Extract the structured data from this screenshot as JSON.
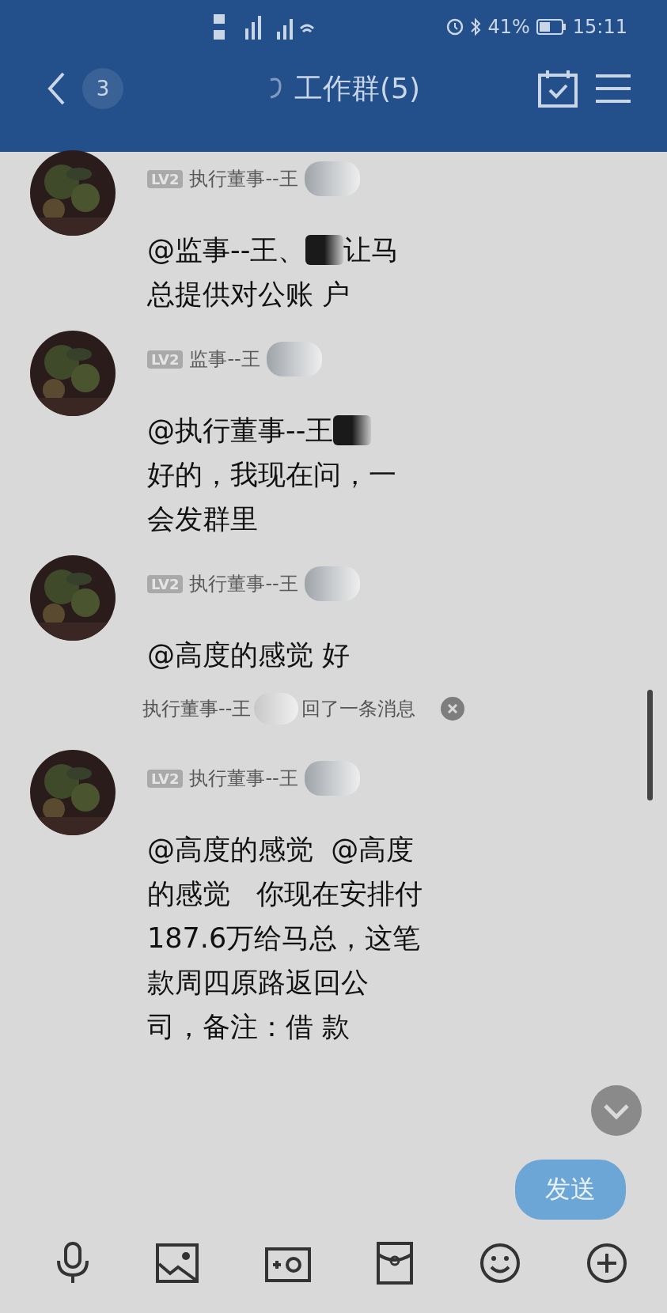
{
  "status_bar": {
    "battery": "41%",
    "time": "15:11"
  },
  "header": {
    "unread": "3",
    "title": "工作群(5)"
  },
  "messages": [
    {
      "kind": "message",
      "badge": "LV2",
      "sender": "执行董事--王",
      "sender_redacted": true,
      "lines": [
        {
          "before": "@监事--王、",
          "redacted": true,
          "after": "让马"
        },
        {
          "before": "总提供对公账 户",
          "redacted": false
        }
      ]
    },
    {
      "kind": "message",
      "badge": "LV2",
      "sender": "监事--王",
      "sender_redacted": true,
      "lines": [
        {
          "before": "@执行董事--王",
          "redacted": true
        },
        {
          "before": "好的，我现在问，一",
          "redacted": false
        },
        {
          "before": "会发群里",
          "redacted": false
        }
      ]
    },
    {
      "kind": "message",
      "badge": "LV2",
      "sender": "执行董事--王",
      "sender_redacted": true,
      "lines": [
        {
          "before": "@高度的感觉 好",
          "redacted": false
        }
      ]
    },
    {
      "kind": "recall",
      "before": "执行董事--王",
      "redacted": true,
      "after": "回了一条消息"
    },
    {
      "kind": "message",
      "badge": "LV2",
      "sender": "执行董事--王",
      "sender_redacted": true,
      "lines": [
        {
          "before": "@高度的感觉  @高度",
          "redacted": false
        },
        {
          "before": "的感觉   你现在安排付",
          "redacted": false
        },
        {
          "before": "187.6万给马总，这笔",
          "redacted": false
        },
        {
          "before": "款周四原路返回公",
          "redacted": false
        },
        {
          "before": "司，备注：借 款",
          "redacted": false
        }
      ]
    }
  ],
  "send_button": "发送"
}
